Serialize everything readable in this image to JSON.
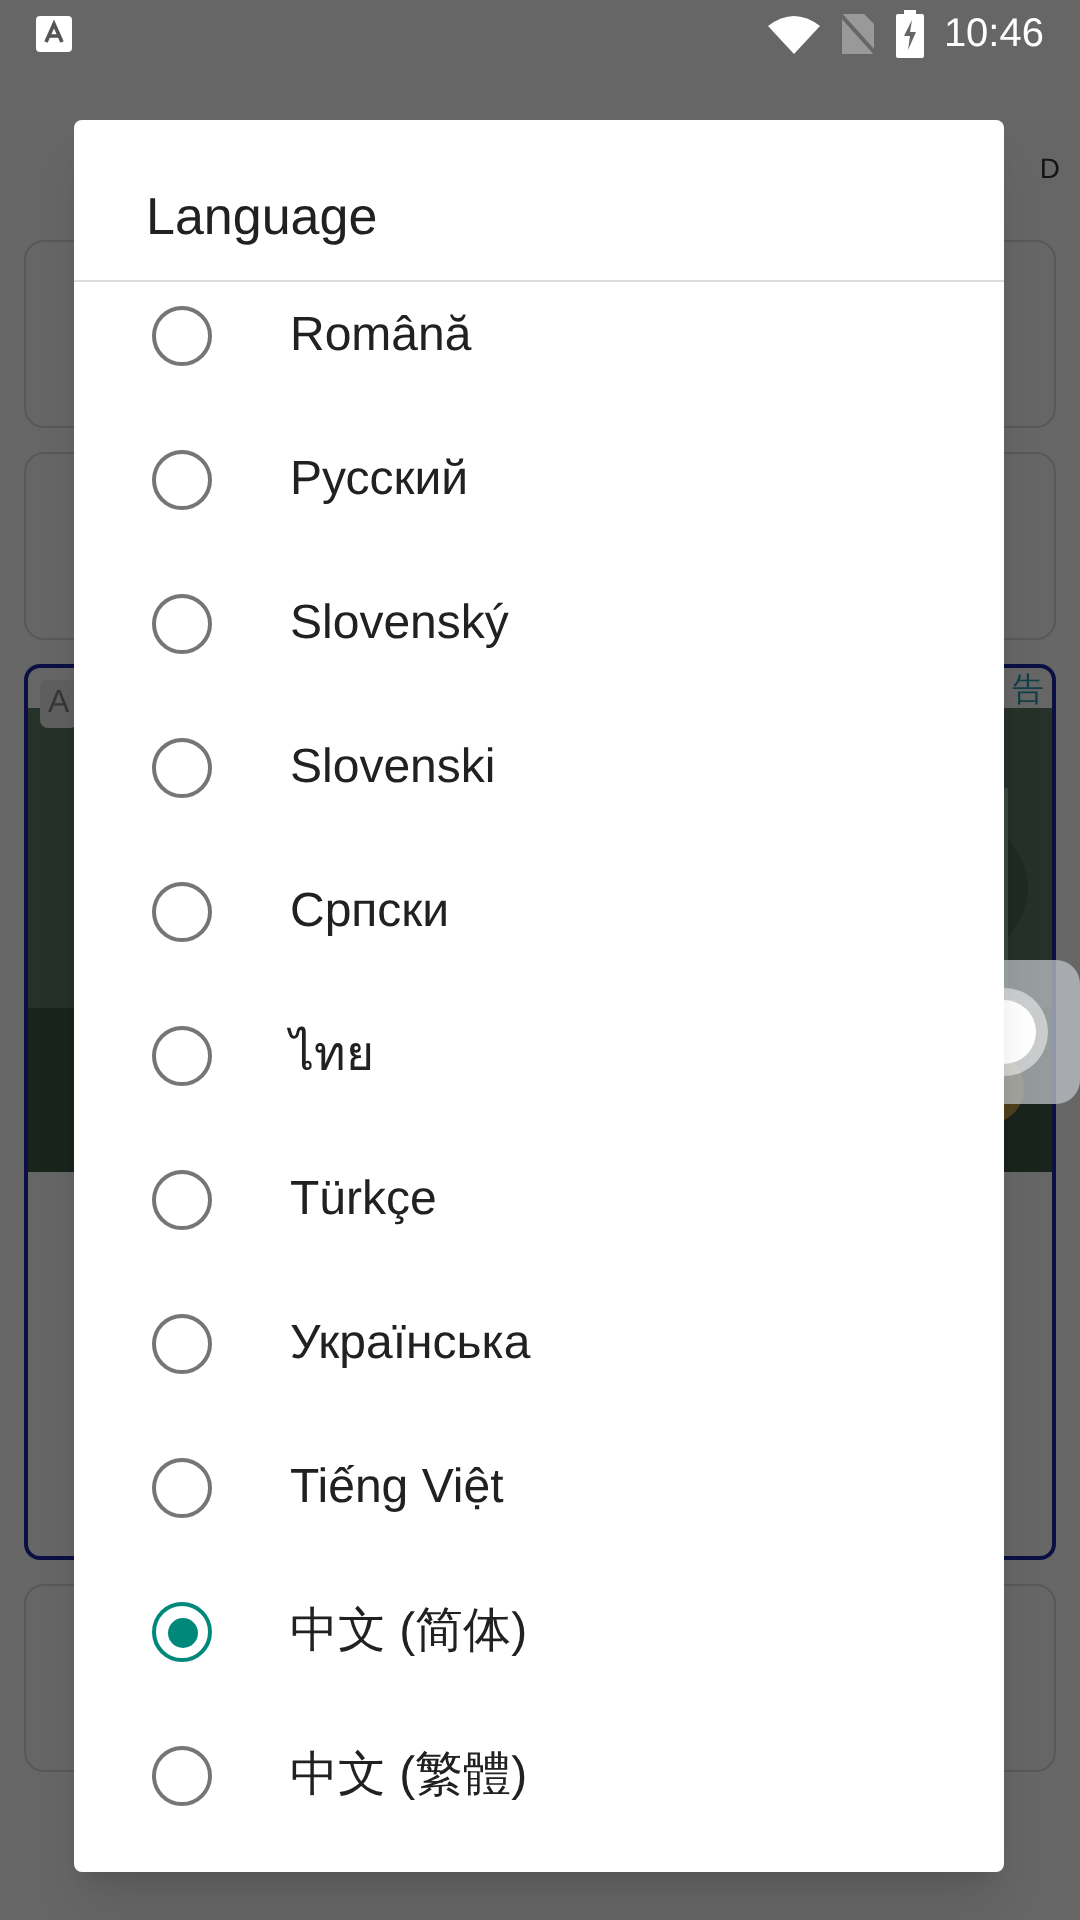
{
  "status_bar": {
    "time": "10:46"
  },
  "background": {
    "header_right": "D",
    "ad_badge": "A",
    "ad_label": "告"
  },
  "dialog": {
    "title": "Language",
    "options": [
      {
        "label": "Română",
        "selected": false
      },
      {
        "label": "Русский",
        "selected": false
      },
      {
        "label": "Slovenský",
        "selected": false
      },
      {
        "label": "Slovenski",
        "selected": false
      },
      {
        "label": "Српски",
        "selected": false
      },
      {
        "label": "ไทย",
        "selected": false
      },
      {
        "label": "Türkçe",
        "selected": false
      },
      {
        "label": "Українська",
        "selected": false
      },
      {
        "label": "Tiếng Việt",
        "selected": false
      },
      {
        "label": "中文 (简体)",
        "selected": true
      },
      {
        "label": "中文 (繁體)",
        "selected": false
      }
    ]
  }
}
